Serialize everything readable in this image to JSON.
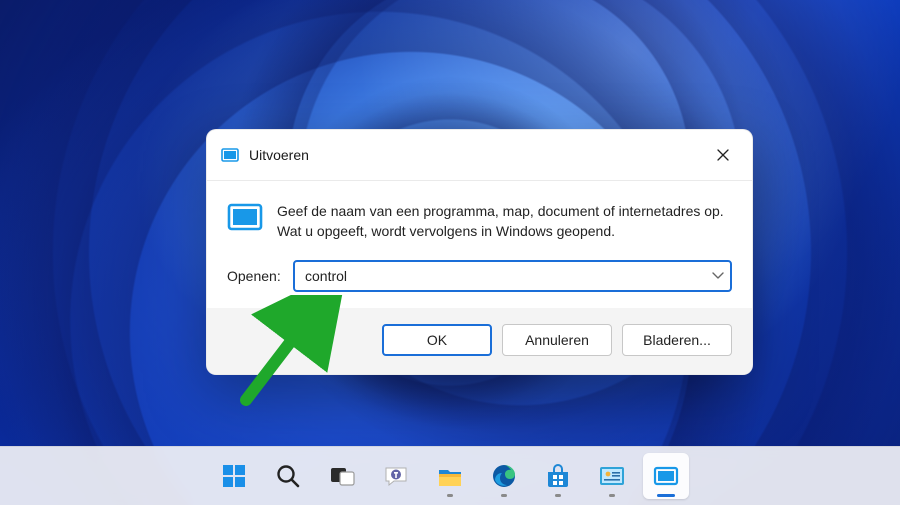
{
  "dialog": {
    "title": "Uitvoeren",
    "description": "Geef de naam van een programma, map, document of internetadres op. Wat u opgeeft, wordt vervolgens in Windows geopend.",
    "open_label": "Openen:",
    "input_value": "control",
    "buttons": {
      "ok": "OK",
      "cancel": "Annuleren",
      "browse": "Bladeren..."
    }
  },
  "taskbar": {
    "items": [
      {
        "name": "start-icon"
      },
      {
        "name": "search-icon"
      },
      {
        "name": "task-view-icon"
      },
      {
        "name": "chat-icon"
      },
      {
        "name": "file-explorer-icon"
      },
      {
        "name": "edge-icon"
      },
      {
        "name": "store-icon"
      },
      {
        "name": "settings-tool-icon"
      },
      {
        "name": "run-icon"
      }
    ]
  },
  "annotation": {
    "arrow_color": "#1fa82b"
  }
}
